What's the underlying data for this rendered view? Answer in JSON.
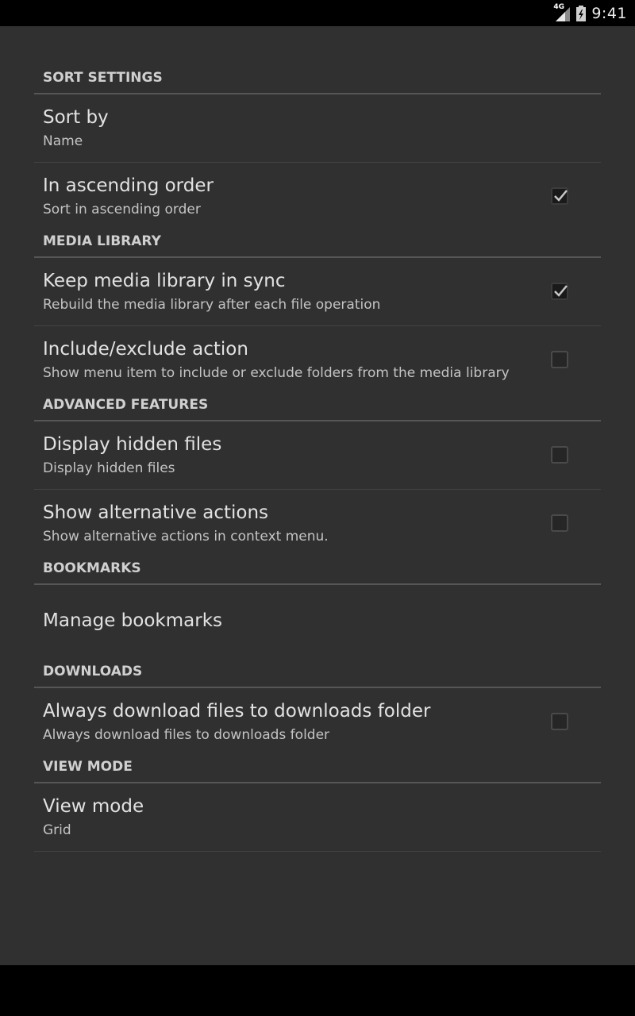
{
  "status_bar": {
    "network_label": "4G",
    "time": "9:41"
  },
  "sections": [
    {
      "title": "SORT SETTINGS",
      "items": [
        {
          "title": "Sort by",
          "summary": "Name",
          "checkbox": null
        },
        {
          "title": "In ascending order",
          "summary": "Sort in ascending order",
          "checkbox": true
        }
      ]
    },
    {
      "title": "MEDIA LIBRARY",
      "items": [
        {
          "title": "Keep media library in sync",
          "summary": "Rebuild the media library after each file operation",
          "checkbox": true
        },
        {
          "title": "Include/exclude action",
          "summary": "Show menu item to include or exclude folders from the media library",
          "checkbox": false
        }
      ]
    },
    {
      "title": "ADVANCED FEATURES",
      "items": [
        {
          "title": "Display hidden files",
          "summary": "Display hidden files",
          "checkbox": false
        },
        {
          "title": "Show alternative actions",
          "summary": "Show alternative actions in context menu.",
          "checkbox": false
        }
      ]
    },
    {
      "title": "BOOKMARKS",
      "items": [
        {
          "title": "Manage bookmarks",
          "summary": "",
          "checkbox": null
        }
      ]
    },
    {
      "title": "DOWNLOADS",
      "items": [
        {
          "title": "Always download files to downloads folder",
          "summary": "Always download files to downloads folder",
          "checkbox": false
        }
      ]
    },
    {
      "title": "VIEW MODE",
      "items": [
        {
          "title": "View mode",
          "summary": "Grid",
          "checkbox": null
        }
      ]
    }
  ],
  "colors": {
    "background": "#303030",
    "text_primary": "#e2e2e2",
    "text_secondary": "#c4c4c4"
  }
}
